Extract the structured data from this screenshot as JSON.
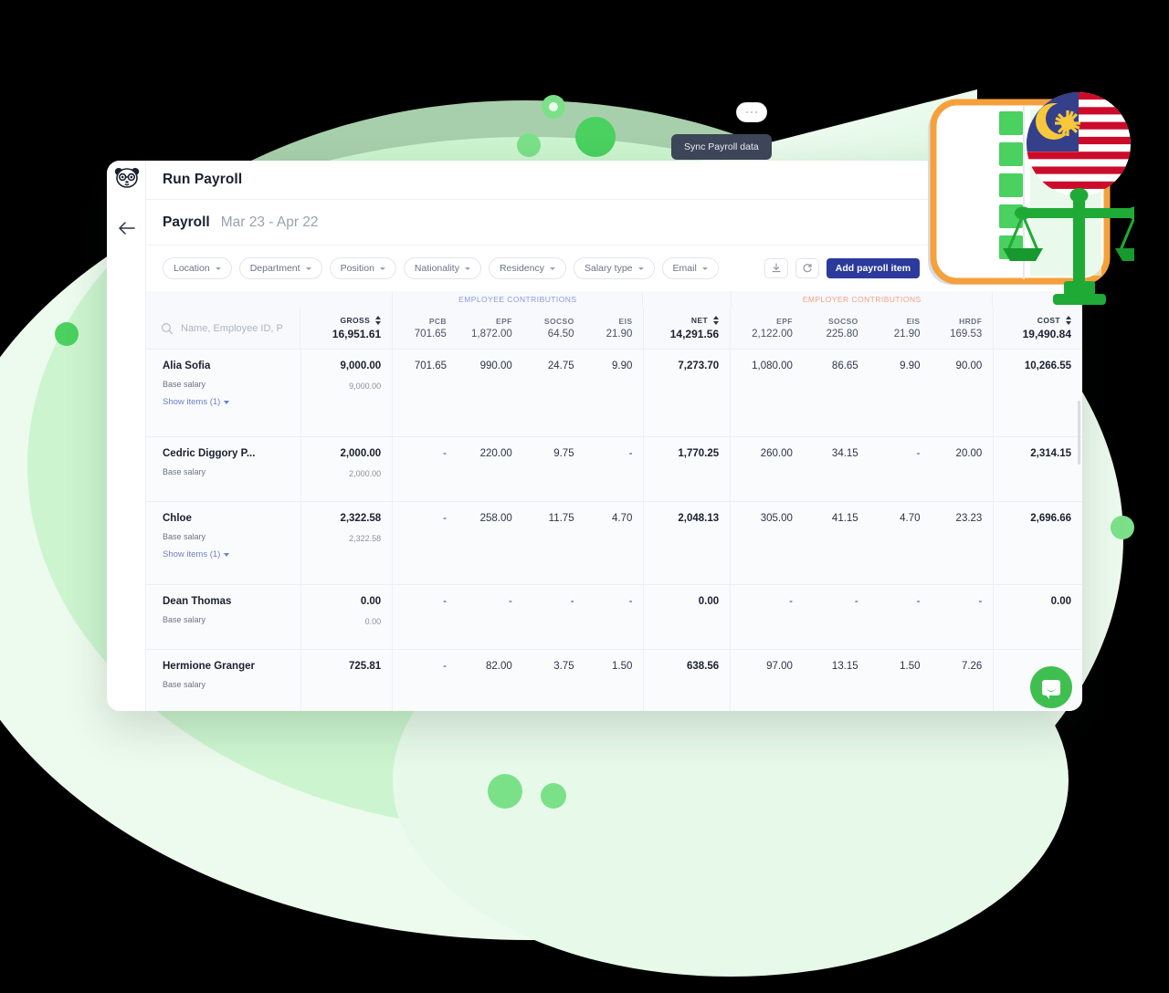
{
  "app": {
    "logo_alt": "panda-logo",
    "title": "Run Payroll"
  },
  "subheader": {
    "label": "Payroll",
    "period": "Mar 23 - Apr 22"
  },
  "filters": [
    {
      "label": "Location"
    },
    {
      "label": "Department"
    },
    {
      "label": "Position"
    },
    {
      "label": "Nationality"
    },
    {
      "label": "Residency"
    },
    {
      "label": "Salary type"
    },
    {
      "label": "Email"
    }
  ],
  "toolbar": {
    "more_label": "...",
    "download_label": "Download",
    "sync_label": "Sync",
    "add_payroll_item": "Add payroll item"
  },
  "tooltip": {
    "text": "Sync Payroll data"
  },
  "table": {
    "group_headers": {
      "employee": "EMPLOYEE CONTRIBUTIONS",
      "employer": "EMPLOYER CONTRIBUTIONS"
    },
    "search": {
      "placeholder": "Name, Employee ID, P",
      "value": ""
    },
    "columns": [
      {
        "key": "GROSS",
        "total": "16,951.61"
      },
      {
        "key": "PCB",
        "total": "701.65"
      },
      {
        "key": "EPF",
        "total": "1,872.00"
      },
      {
        "key": "SOCSO",
        "total": "64.50"
      },
      {
        "key": "EIS",
        "total": "21.90"
      },
      {
        "key": "NET",
        "total": "14,291.56"
      },
      {
        "key": "EPF",
        "total": "2,122.00"
      },
      {
        "key": "SOCSO",
        "total": "225.80"
      },
      {
        "key": "EIS",
        "total": "21.90"
      },
      {
        "key": "HRDF",
        "total": "169.53"
      },
      {
        "key": "COST",
        "total": "19,490.84"
      }
    ],
    "base_salary_label": "Base salary",
    "show_items_label": "Show items (1)",
    "rows": [
      {
        "name": "Alia Sofia",
        "gross": "9,000.00",
        "base_salary": "9,000.00",
        "has_show_items": true,
        "ee_pcb": "701.65",
        "ee_epf": "990.00",
        "ee_socso": "24.75",
        "ee_eis": "9.90",
        "net": "7,273.70",
        "er_epf": "1,080.00",
        "er_socso": "86.65",
        "er_eis": "9.90",
        "er_hrdf": "90.00",
        "cost": "10,266.55"
      },
      {
        "name": "Cedric Diggory P...",
        "gross": "2,000.00",
        "base_salary": "2,000.00",
        "has_show_items": false,
        "ee_pcb": "-",
        "ee_epf": "220.00",
        "ee_socso": "9.75",
        "ee_eis": "-",
        "net": "1,770.25",
        "er_epf": "260.00",
        "er_socso": "34.15",
        "er_eis": "-",
        "er_hrdf": "20.00",
        "cost": "2,314.15"
      },
      {
        "name": "Chloe",
        "gross": "2,322.58",
        "base_salary": "2,322.58",
        "has_show_items": true,
        "ee_pcb": "-",
        "ee_epf": "258.00",
        "ee_socso": "11.75",
        "ee_eis": "4.70",
        "net": "2,048.13",
        "er_epf": "305.00",
        "er_socso": "41.15",
        "er_eis": "4.70",
        "er_hrdf": "23.23",
        "cost": "2,696.66"
      },
      {
        "name": "Dean Thomas",
        "gross": "0.00",
        "base_salary": "0.00",
        "has_show_items": false,
        "ee_pcb": "-",
        "ee_epf": "-",
        "ee_socso": "-",
        "ee_eis": "-",
        "net": "0.00",
        "er_epf": "-",
        "er_socso": "-",
        "er_eis": "-",
        "er_hrdf": "-",
        "cost": "0.00"
      },
      {
        "name": "Hermione Granger",
        "gross": "725.81",
        "base_salary": "",
        "has_show_items": false,
        "ee_pcb": "-",
        "ee_epf": "82.00",
        "ee_socso": "3.75",
        "ee_eis": "1.50",
        "net": "638.56",
        "er_epf": "97.00",
        "er_socso": "13.15",
        "er_eis": "1.50",
        "er_hrdf": "7.26",
        "cost": ""
      }
    ]
  },
  "chat": {
    "label": "chat-widget"
  },
  "colors": {
    "primary_button": "#2b3a9c",
    "employee_group": "#8b9adf",
    "employer_group": "#f2a185",
    "accent_green": "#4ad15f",
    "link": "#6f7ec9",
    "tooltip_bg": "#3d4558"
  }
}
